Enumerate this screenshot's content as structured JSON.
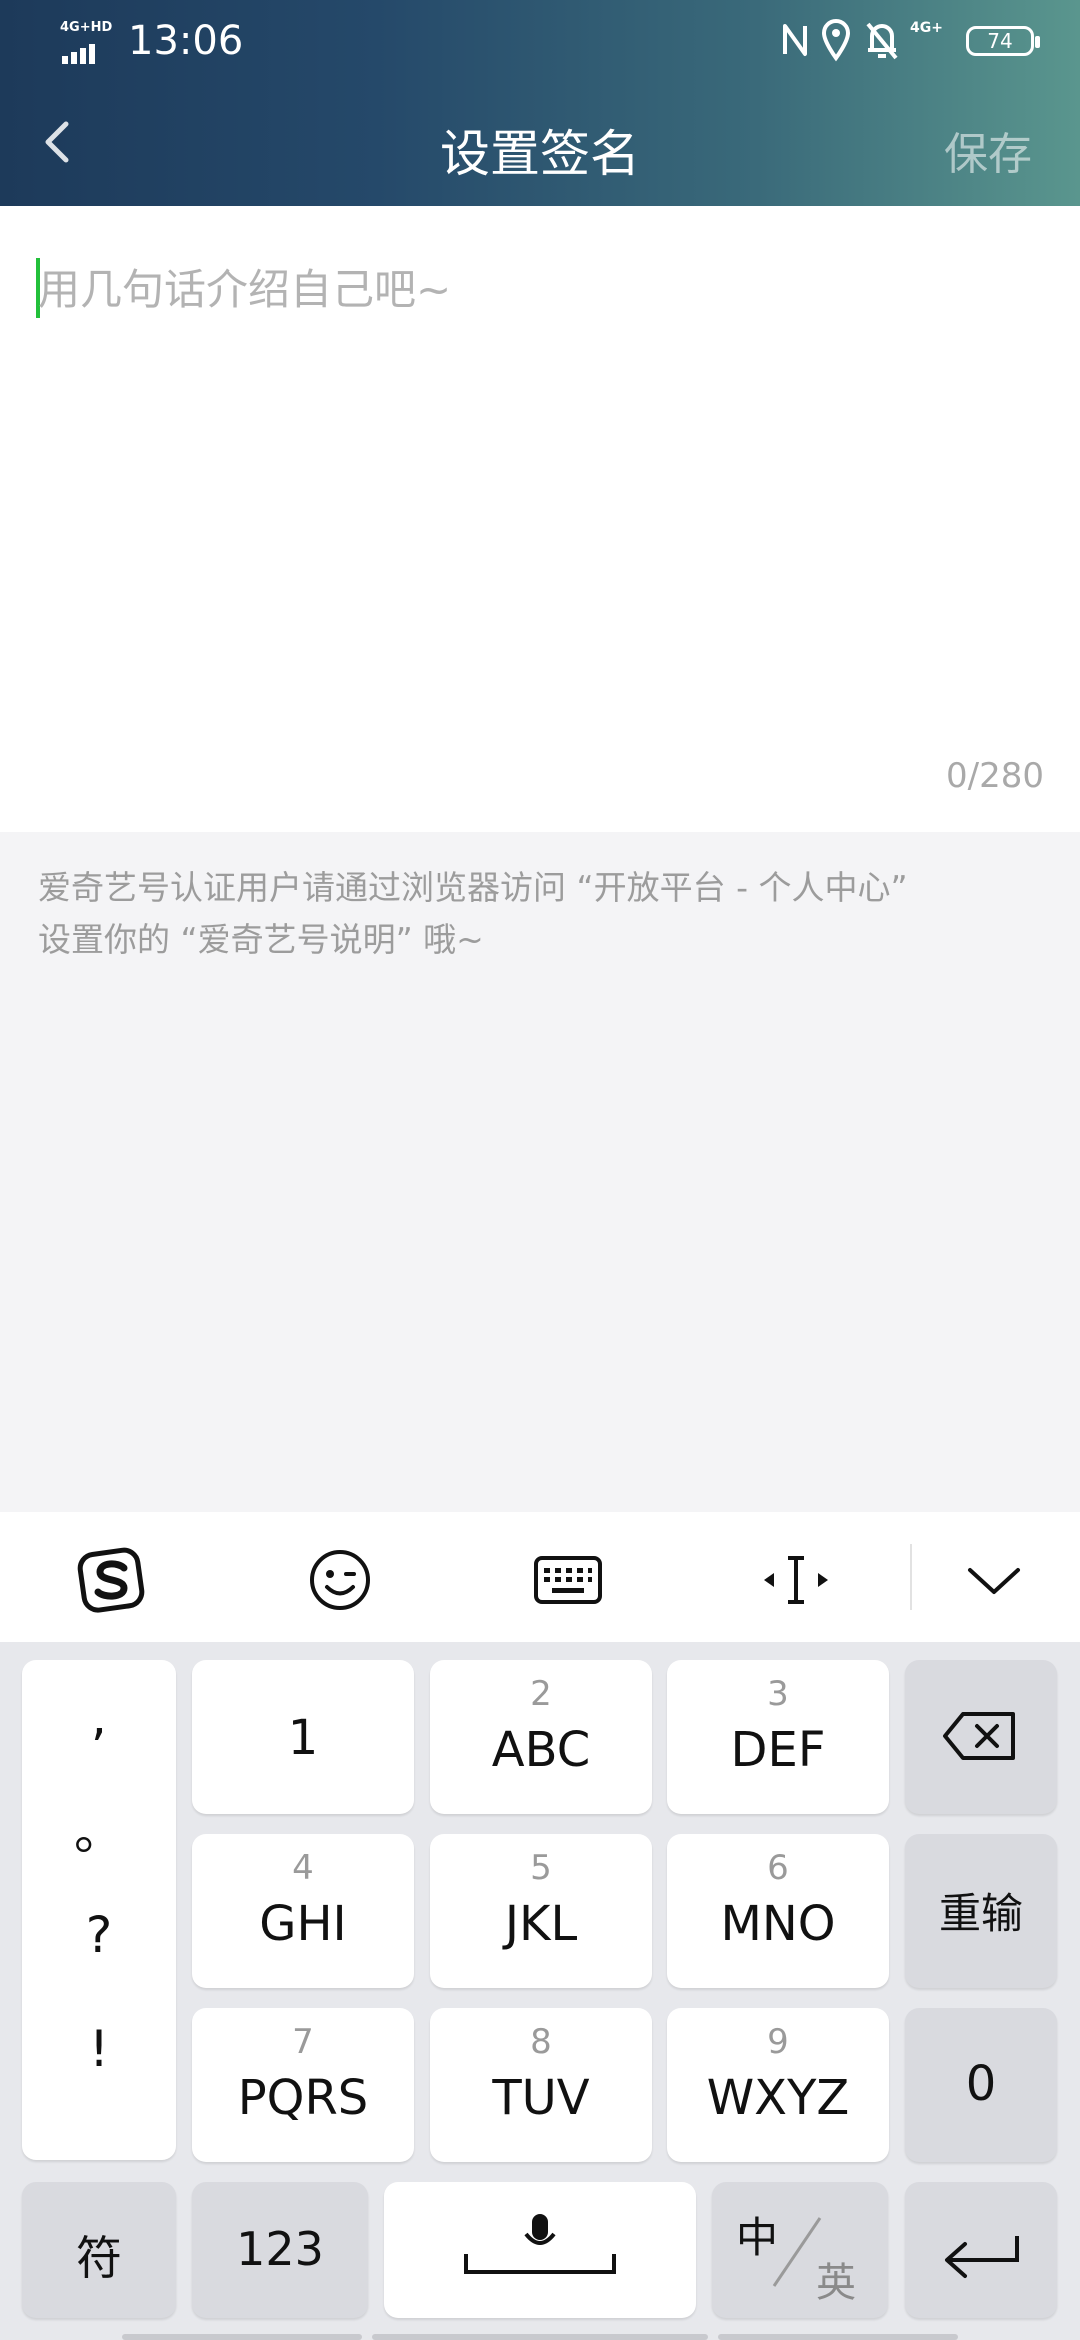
{
  "status_bar": {
    "network": "4G+HD",
    "time": "13:06",
    "network2": "4G+",
    "battery": "74"
  },
  "nav": {
    "title": "设置签名",
    "save_label": "保存"
  },
  "editor": {
    "placeholder": "用几句话介绍自己吧~",
    "value": "",
    "char_count": "0/280"
  },
  "hint": {
    "line1": "爱奇艺号认证用户请通过浏览器访问 “开放平台 - 个人中心”",
    "line2": "设置你的 “爱奇艺号说明” 哦~"
  },
  "keyboard_toolbar": {
    "items": [
      "sogou-logo-icon",
      "emoji-icon",
      "keyboard-icon",
      "cursor-move-icon",
      "chevron-down-icon"
    ]
  },
  "keyboard": {
    "punctuation": [
      ",",
      "。",
      "?",
      "!"
    ],
    "keys": [
      {
        "num": "",
        "letters": "1"
      },
      {
        "num": "2",
        "letters": "ABC"
      },
      {
        "num": "3",
        "letters": "DEF"
      },
      {
        "num": "4",
        "letters": "GHI"
      },
      {
        "num": "5",
        "letters": "JKL"
      },
      {
        "num": "6",
        "letters": "MNO"
      },
      {
        "num": "7",
        "letters": "PQRS"
      },
      {
        "num": "8",
        "letters": "TUV"
      },
      {
        "num": "9",
        "letters": "WXYZ"
      }
    ],
    "reenter_label": "重输",
    "zero_label": "0",
    "symbol_label": "符",
    "numbers_label": "123",
    "lang_primary": "中",
    "lang_secondary": "英"
  }
}
